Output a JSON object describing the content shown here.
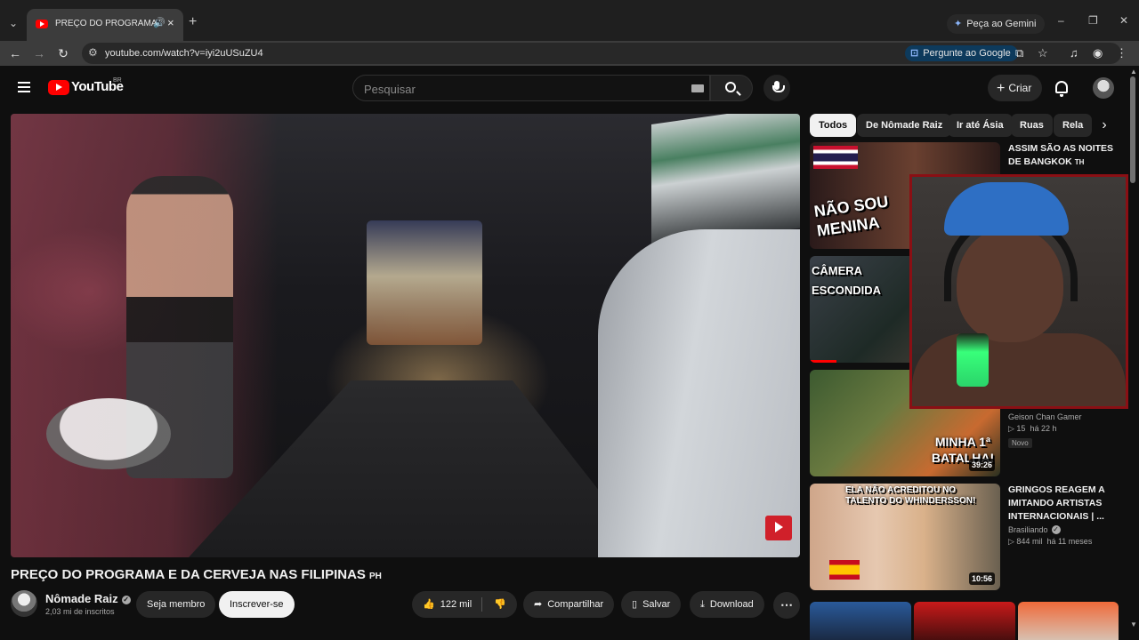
{
  "browser": {
    "tab_title": "PREÇO DO PROGRAMA E DA CERVEJA NAS FILIPINAS",
    "gemini_label": "Peça ao Gemini",
    "url": "youtube.com/watch?v=iyi2uUSuZU4",
    "ask_google_label": "Pergunte ao Google"
  },
  "header": {
    "logo_text": "YouTube",
    "region": "BR",
    "search_placeholder": "Pesquisar",
    "create_label": "Criar"
  },
  "video": {
    "title": "PREÇO DO PROGRAMA E DA CERVEJA NAS FILIPINAS",
    "title_flag": "PH",
    "channel_name": "Nômade Raiz",
    "subscribers": "2,03 mi de inscritos",
    "join_label": "Seja membro",
    "subscribe_label": "Inscrever-se",
    "likes": "122 mil",
    "share_label": "Compartilhar",
    "save_label": "Salvar",
    "download_label": "Download"
  },
  "chips": [
    "Todos",
    "De Nômade Raiz",
    "Ir até Ásia",
    "Ruas",
    "Rela"
  ],
  "recommendations": [
    {
      "title": "ASSIM SÃO AS NOITES DE BANGKOK",
      "title_flag": "TH",
      "thumb_text": "NÃO SOU MENINA"
    },
    {
      "thumb_text": "CÂMERA ESCONDIDA"
    },
    {
      "channel": "Geison Chan Gamer",
      "views": "15",
      "age": "há 22 h",
      "badge": "Novo",
      "thumb_text": "MINHA 1ª BATALHA!",
      "duration": "39:26"
    },
    {
      "title": "GRINGOS REAGEM A IMITANDO ARTISTAS INTERNACIONAIS | ...",
      "channel": "Brasiliando",
      "views": "844 mil",
      "age": "há 11 meses",
      "thumb_text_1": "ELA NÃO ACREDITOU NO",
      "thumb_text_2": "TALENTO DO WHINDERSSON!",
      "duration": "10:56"
    }
  ],
  "colors": {
    "youtube_red": "#ff0000",
    "background": "#0f0f0f",
    "webcam_border": "#8a0f14"
  }
}
